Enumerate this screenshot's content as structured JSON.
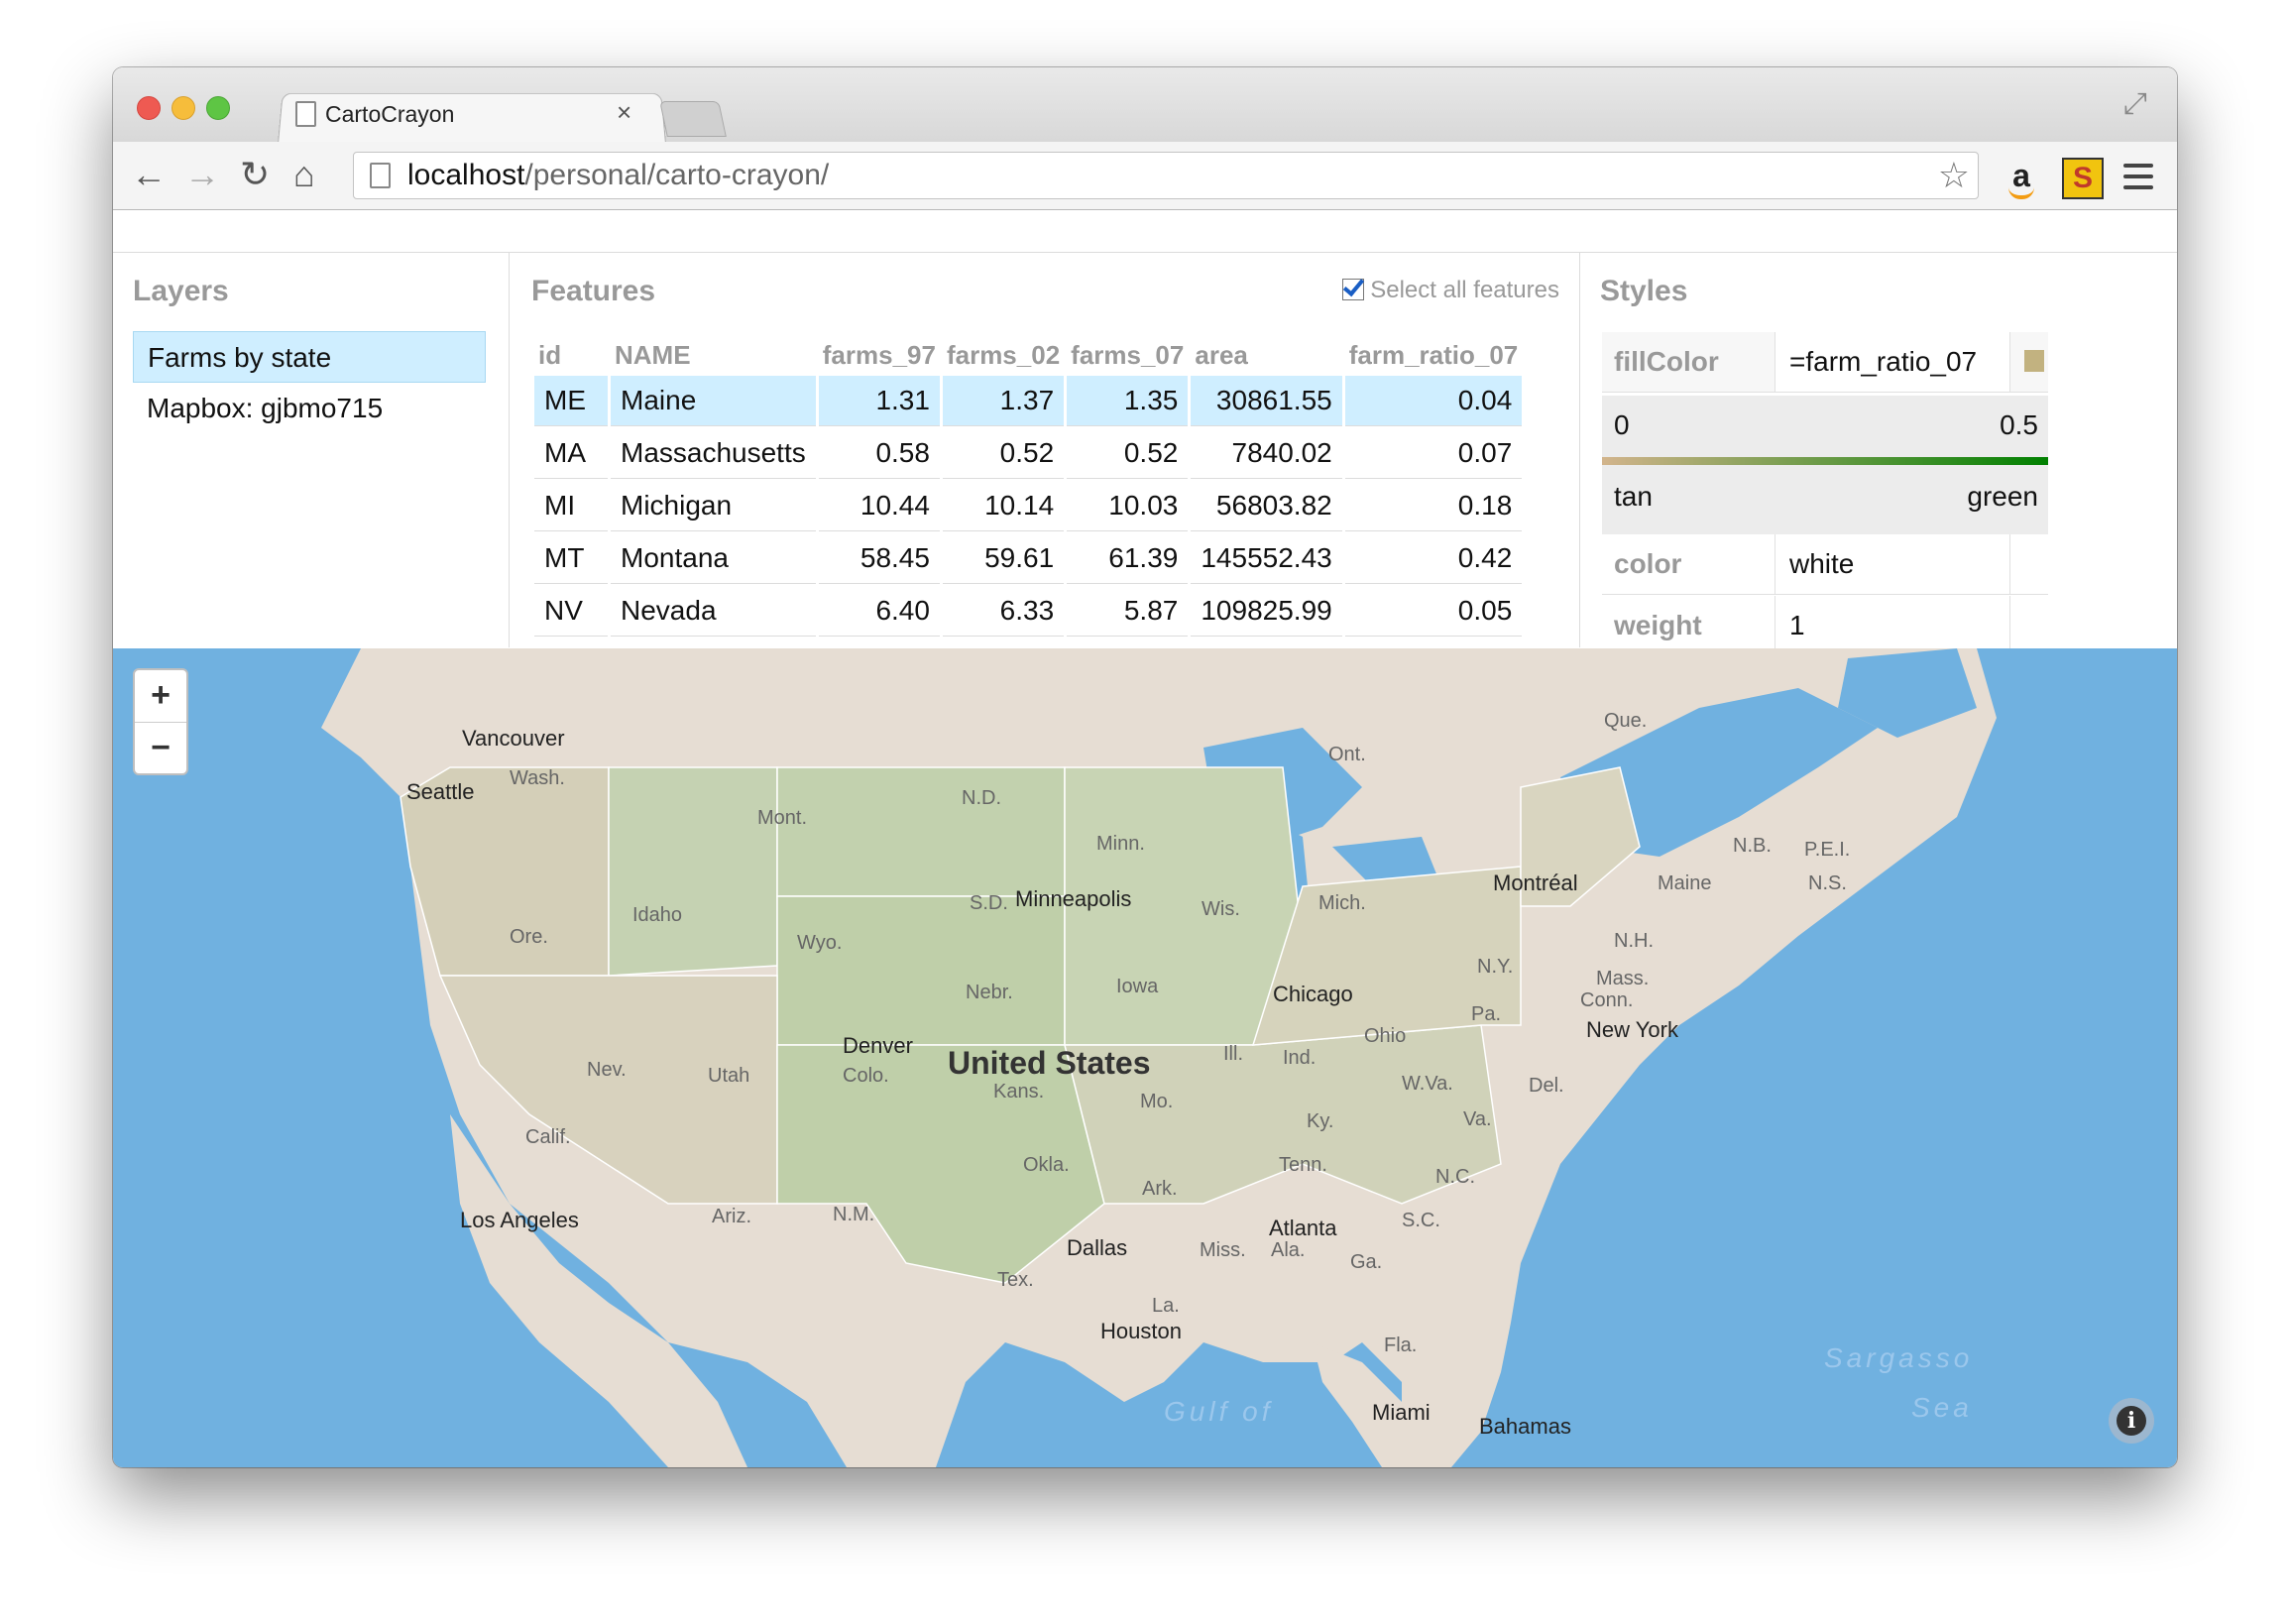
{
  "browser": {
    "tab_title": "CartoCrayon",
    "tab_close": "×",
    "url_host": "localhost",
    "url_path": "/personal/carto-crayon/"
  },
  "layers": {
    "title": "Layers",
    "items": [
      {
        "label": "Farms by state",
        "selected": true
      },
      {
        "label": "Mapbox: gjbmo715",
        "selected": false
      }
    ]
  },
  "features": {
    "title": "Features",
    "select_all_label": "Select all features",
    "columns": [
      "id",
      "NAME",
      "farms_97",
      "farms_02",
      "farms_07",
      "area",
      "farm_ratio_07"
    ],
    "rows": [
      {
        "id": "ME",
        "name": "Maine",
        "farms_97": "1.31",
        "farms_02": "1.37",
        "farms_07": "1.35",
        "area": "30861.55",
        "farm_ratio_07": "0.04",
        "selected": true
      },
      {
        "id": "MA",
        "name": "Massachusetts",
        "farms_97": "0.58",
        "farms_02": "0.52",
        "farms_07": "0.52",
        "area": "7840.02",
        "farm_ratio_07": "0.07",
        "selected": false
      },
      {
        "id": "MI",
        "name": "Michigan",
        "farms_97": "10.44",
        "farms_02": "10.14",
        "farms_07": "10.03",
        "area": "56803.82",
        "farm_ratio_07": "0.18",
        "selected": false
      },
      {
        "id": "MT",
        "name": "Montana",
        "farms_97": "58.45",
        "farms_02": "59.61",
        "farms_07": "61.39",
        "area": "145552.43",
        "farm_ratio_07": "0.42",
        "selected": false
      },
      {
        "id": "NV",
        "name": "Nevada",
        "farms_97": "6.40",
        "farms_02": "6.33",
        "farms_07": "5.87",
        "area": "109825.99",
        "farm_ratio_07": "0.05",
        "selected": false
      }
    ]
  },
  "styles": {
    "title": "Styles",
    "fill_label": "fillColor",
    "fill_value": "=farm_ratio_07",
    "fill_swatch_color": "#c2b280",
    "scale_min": "0",
    "scale_max": "0.5",
    "scale_min_color": "tan",
    "scale_max_color": "green",
    "scale_start_hex": "#d2b48c",
    "scale_end_hex": "#008000",
    "color_label": "color",
    "color_value": "white",
    "weight_label": "weight",
    "weight_value": "1"
  },
  "map": {
    "zoom_in": "+",
    "zoom_out": "−",
    "info": "i",
    "water_color": "#70b1e0",
    "land_color": "#e6ddd3",
    "labels": {
      "vancouver": "Vancouver",
      "seattle": "Seattle",
      "wash": "Wash.",
      "mont": "Mont.",
      "nd": "N.D.",
      "minn": "Minn.",
      "ont": "Ont.",
      "que": "Que.",
      "nb": "N.B.",
      "pei": "P.E.I.",
      "ns": "N.S.",
      "montreal": "Montréal",
      "maine": "Maine",
      "ore": "Ore.",
      "idaho": "Idaho",
      "wyo": "Wyo.",
      "sd": "S.D.",
      "minneapolis": "Minneapolis",
      "wis": "Wis.",
      "mich": "Mich.",
      "nh": "N.H.",
      "mass": "Mass.",
      "conn": "Conn.",
      "ny": "N.Y.",
      "newyork": "New York",
      "nebr": "Nebr.",
      "iowa": "Iowa",
      "chicago": "Chicago",
      "ill": "Ill.",
      "ind": "Ind.",
      "ohio": "Ohio",
      "pa": "Pa.",
      "del": "Del.",
      "nev": "Nev.",
      "utah": "Utah",
      "denver": "Denver",
      "colo": "Colo.",
      "unitedstates": "United States",
      "kans": "Kans.",
      "mo": "Mo.",
      "wva": "W.Va.",
      "va": "Va.",
      "ky": "Ky.",
      "calif": "Calif.",
      "tenn": "Tenn.",
      "nc": "N.C.",
      "okla": "Okla.",
      "ark": "Ark.",
      "losangeles": "Los Angeles",
      "ariz": "Ariz.",
      "nm": "N.M.",
      "atlanta": "Atlanta",
      "sc": "S.C.",
      "ala": "Ala.",
      "miss": "Miss.",
      "ga": "Ga.",
      "dallas": "Dallas",
      "tex": "Tex.",
      "la": "La.",
      "houston": "Houston",
      "fla": "Fla.",
      "miami": "Miami",
      "bahamas": "Bahamas",
      "gulf": "Gulf of",
      "sargasso": "Sargasso",
      "sea": "Sea"
    }
  }
}
